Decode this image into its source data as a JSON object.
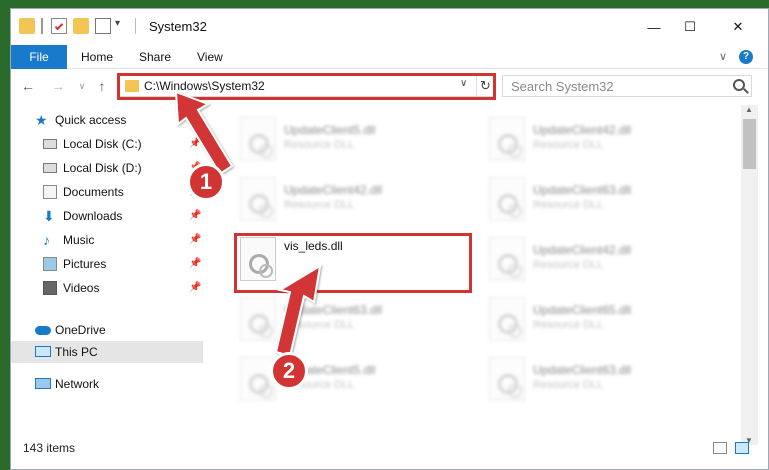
{
  "window": {
    "title": "System32",
    "controls": {
      "minimize": "—",
      "maximize": "☐",
      "close": "✕"
    }
  },
  "ribbon": {
    "tabs": [
      "File",
      "Home",
      "Share",
      "View"
    ],
    "help": "?",
    "expand": "∨"
  },
  "nav": {
    "address": "C:\\Windows\\System32",
    "search_placeholder": "Search System32",
    "refresh": "↻",
    "dropdown": "∨"
  },
  "sidebar": {
    "quick_access": "Quick access",
    "items": [
      {
        "label": "Local Disk (C:)",
        "icon": "drive-icon"
      },
      {
        "label": "Local Disk (D:)",
        "icon": "drive-icon"
      },
      {
        "label": "Documents",
        "icon": "documents-icon"
      },
      {
        "label": "Downloads",
        "icon": "download-icon"
      },
      {
        "label": "Music",
        "icon": "music-icon"
      },
      {
        "label": "Pictures",
        "icon": "pictures-icon"
      },
      {
        "label": "Videos",
        "icon": "videos-icon"
      }
    ],
    "onedrive": "OneDrive",
    "thispc": "This PC",
    "network": "Network"
  },
  "files": {
    "left": [
      {
        "name": "UpdateClient5.dll",
        "type": "Resource DLL"
      },
      {
        "name": "UpdateClient42.dll",
        "type": "Resource DLL"
      },
      {
        "name": "vis_leds.dll",
        "type": ""
      },
      {
        "name": "UpdateClient63.dll",
        "type": "Resource DLL"
      },
      {
        "name": "UpdateClient5.dll",
        "type": "Resource DLL"
      }
    ],
    "right": [
      {
        "name": "UpdateClient42.dll",
        "type": "Resource DLL"
      },
      {
        "name": "UpdateClient63.dll",
        "type": "Resource DLL"
      },
      {
        "name": "UpdateClient42.dll",
        "type": "Resource DLL"
      },
      {
        "name": "UpdateClient65.dll",
        "type": "Resource DLL"
      },
      {
        "name": "UpdateClient63.dll",
        "type": "Resource DLL"
      }
    ]
  },
  "status": {
    "count": "143 items"
  },
  "badges": [
    "1",
    "2"
  ],
  "colors": {
    "accent": "#1979ca",
    "highlight": "#d23434",
    "folder": "#f3c554"
  }
}
